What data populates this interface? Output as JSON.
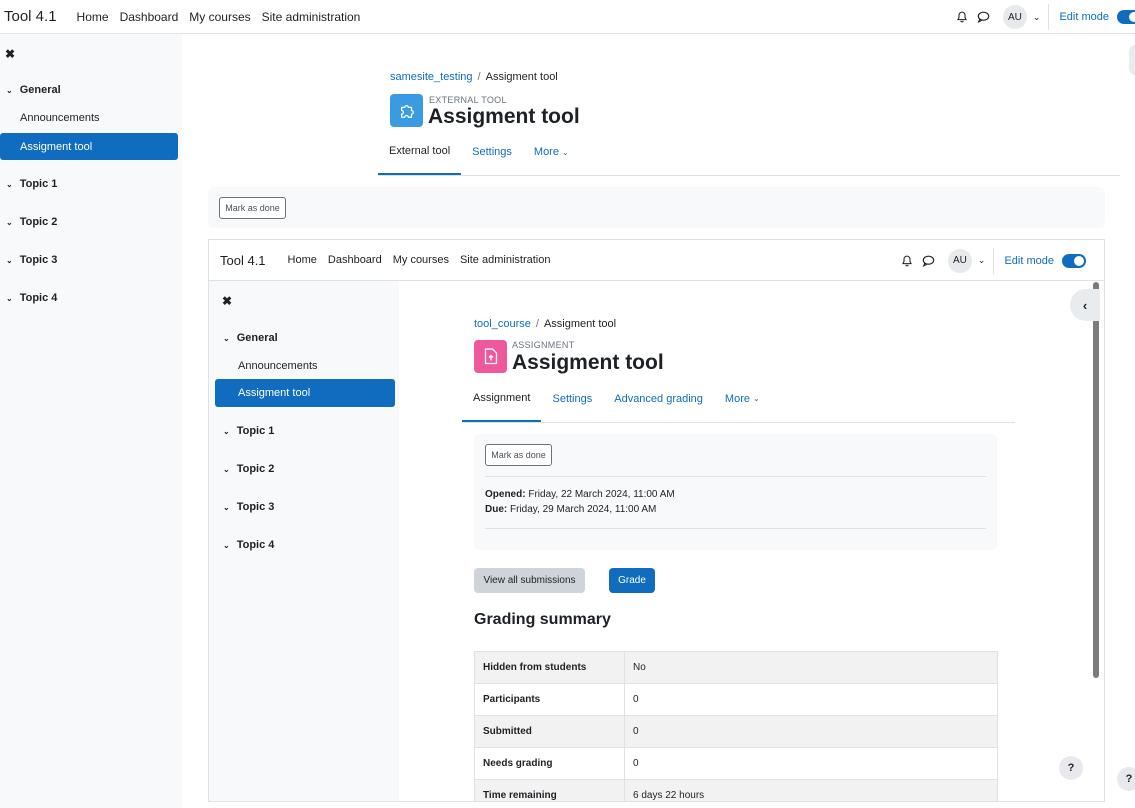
{
  "outer": {
    "brand": "Tool 4.1",
    "nav": [
      "Home",
      "Dashboard",
      "My courses",
      "Site administration"
    ],
    "avatar": "AU",
    "edit_mode": "Edit mode",
    "drawer": {
      "close": "✖",
      "sections": [
        "General",
        "Topic 1",
        "Topic 2",
        "Topic 3",
        "Topic 4"
      ],
      "activities": [
        "Announcements",
        "Assigment tool"
      ]
    },
    "breadcrumb": {
      "parent": "samesite_testing",
      "current": "Assigment tool"
    },
    "module_type": "EXTERNAL TOOL",
    "title": "Assigment tool",
    "tabs": [
      "External tool",
      "Settings",
      "More"
    ],
    "mark_done": "Mark as done",
    "help": "?"
  },
  "inner": {
    "brand": "Tool 4.1",
    "nav": [
      "Home",
      "Dashboard",
      "My courses",
      "Site administration"
    ],
    "avatar": "AU",
    "edit_mode": "Edit mode",
    "drawer": {
      "close": "✖",
      "sections": [
        "General",
        "Topic 1",
        "Topic 2",
        "Topic 3",
        "Topic 4"
      ],
      "activities": [
        "Announcements",
        "Assigment tool"
      ]
    },
    "breadcrumb": {
      "parent": "tool_course",
      "current": "Assigment tool"
    },
    "module_type": "ASSIGNMENT",
    "title": "Assigment tool",
    "tabs": [
      "Assignment",
      "Settings",
      "Advanced grading",
      "More"
    ],
    "mark_done": "Mark as done",
    "opened_label": "Opened:",
    "opened_value": "Friday, 22 March 2024, 11:00 AM",
    "due_label": "Due:",
    "due_value": "Friday, 29 March 2024, 11:00 AM",
    "view_all": "View all submissions",
    "grade": "Grade",
    "grading_summary": "Grading summary",
    "summary": [
      {
        "k": "Hidden from students",
        "v": "No"
      },
      {
        "k": "Participants",
        "v": "0"
      },
      {
        "k": "Submitted",
        "v": "0"
      },
      {
        "k": "Needs grading",
        "v": "0"
      },
      {
        "k": "Time remaining",
        "v": "6 days 22 hours"
      }
    ],
    "help": "?"
  },
  "colors": {
    "primary": "#0f6cbf",
    "lti_icon": "#399be2",
    "assign_icon": "#f0589c"
  },
  "icons": [
    "bell-icon",
    "chat-icon",
    "puzzle-icon",
    "upload-file-icon",
    "chevron-left-icon",
    "close-icon"
  ]
}
